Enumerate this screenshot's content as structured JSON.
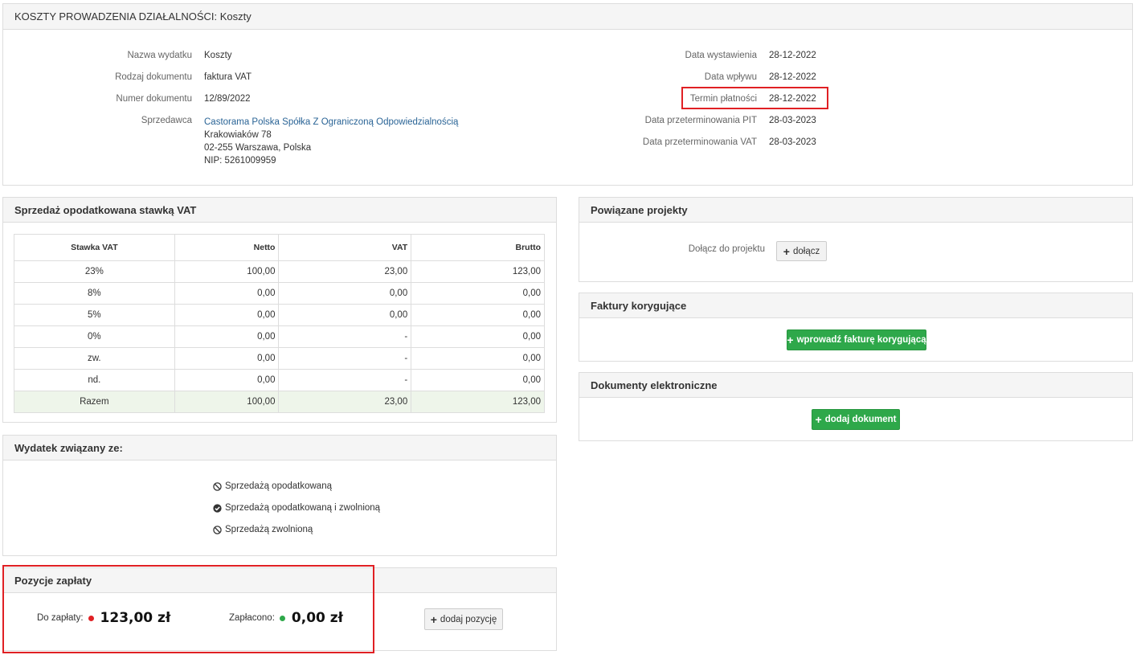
{
  "header": {
    "title": "KOSZTY PROWADZENIA DZIAŁALNOŚCI: Koszty"
  },
  "details": {
    "left": [
      {
        "label": "Nazwa wydatku",
        "value": "Koszty"
      },
      {
        "label": "Rodzaj dokumentu",
        "value": "faktura VAT"
      },
      {
        "label": "Numer dokumentu",
        "value": "12/89/2022"
      }
    ],
    "seller": {
      "label": "Sprzedawca",
      "name": "Castorama Polska Spółka Z Ograniczoną Odpowiedzialnością",
      "street": "Krakowiaków 78",
      "city": "02-255 Warszawa, Polska",
      "nip": "NIP: 5261009959"
    },
    "right": [
      {
        "label": "Data wystawienia",
        "value": "28-12-2022"
      },
      {
        "label": "Data wpływu",
        "value": "28-12-2022"
      },
      {
        "label": "Termin płatności",
        "value": "28-12-2022"
      },
      {
        "label": "Data przeterminowania PIT",
        "value": "28-03-2023"
      },
      {
        "label": "Data przeterminowania VAT",
        "value": "28-03-2023"
      }
    ]
  },
  "vat_panel": {
    "title": "Sprzedaż opodatkowana stawką VAT",
    "columns": [
      "Stawka VAT",
      "Netto",
      "VAT",
      "Brutto"
    ],
    "rows": [
      [
        "23%",
        "100,00",
        "23,00",
        "123,00"
      ],
      [
        "8%",
        "0,00",
        "0,00",
        "0,00"
      ],
      [
        "5%",
        "0,00",
        "0,00",
        "0,00"
      ],
      [
        "0%",
        "0,00",
        "-",
        "0,00"
      ],
      [
        "zw.",
        "0,00",
        "-",
        "0,00"
      ],
      [
        "nd.",
        "0,00",
        "-",
        "0,00"
      ]
    ],
    "total": [
      "Razem",
      "100,00",
      "23,00",
      "123,00"
    ]
  },
  "expense_related": {
    "title": "Wydatek związany ze:",
    "options": [
      {
        "label": "Sprzedażą opodatkowaną",
        "checked": false
      },
      {
        "label": "Sprzedażą opodatkowaną i zwolnioną",
        "checked": true
      },
      {
        "label": "Sprzedażą zwolnioną",
        "checked": false
      }
    ]
  },
  "payments": {
    "title": "Pozycje zapłaty",
    "due_label": "Do zapłaty:",
    "due_amount": "123,00 zł",
    "paid_label": "Zapłacono:",
    "paid_amount": "0,00 zł",
    "add_label": "dodaj pozycję",
    "due_color": "#e02024",
    "paid_color": "#2ea84a"
  },
  "projects": {
    "title": "Powiązane projekty",
    "join_label": "Dołącz do projektu",
    "join_button": "dołącz"
  },
  "corrections": {
    "title": "Faktury korygujące",
    "button": "wprowadź fakturę korygującą"
  },
  "edocs": {
    "title": "Dokumenty elektroniczne",
    "button": "dodaj dokument"
  },
  "colors": {
    "accent_green": "#2ea84a",
    "highlight_red": "#e02024",
    "link_blue": "#2a6496"
  }
}
